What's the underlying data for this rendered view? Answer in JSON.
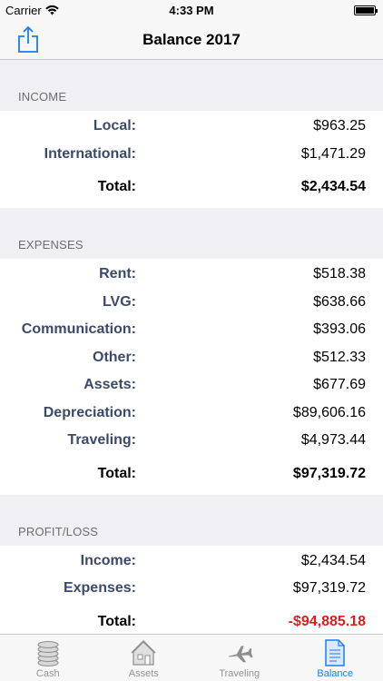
{
  "status_bar": {
    "carrier": "Carrier",
    "time": "4:33 PM"
  },
  "nav": {
    "title": "Balance 2017"
  },
  "income": {
    "header": "INCOME",
    "rows": [
      {
        "label": "Local:",
        "value": "$963.25"
      },
      {
        "label": "International:",
        "value": "$1,471.29"
      }
    ],
    "total": {
      "label": "Total:",
      "value": "$2,434.54"
    }
  },
  "expenses": {
    "header": "EXPENSES",
    "rows": [
      {
        "label": "Rent:",
        "value": "$518.38"
      },
      {
        "label": "LVG:",
        "value": "$638.66"
      },
      {
        "label": "Communication:",
        "value": "$393.06"
      },
      {
        "label": "Other:",
        "value": "$512.33"
      },
      {
        "label": "Assets:",
        "value": "$677.69"
      },
      {
        "label": "Depreciation:",
        "value": "$89,606.16"
      },
      {
        "label": "Traveling:",
        "value": "$4,973.44"
      }
    ],
    "total": {
      "label": "Total:",
      "value": "$97,319.72"
    }
  },
  "profit_loss": {
    "header": "PROFIT/LOSS",
    "rows": [
      {
        "label": "Income:",
        "value": "$2,434.54"
      },
      {
        "label": "Expenses:",
        "value": "$97,319.72"
      }
    ],
    "total": {
      "label": "Total:",
      "value": "-$94,885.18"
    }
  },
  "tabs": [
    {
      "label": "Cash",
      "icon": "coins-icon",
      "active": false
    },
    {
      "label": "Assets",
      "icon": "house-icon",
      "active": false
    },
    {
      "label": "Traveling",
      "icon": "airplane-icon",
      "active": false
    },
    {
      "label": "Balance",
      "icon": "document-icon",
      "active": true
    }
  ],
  "colors": {
    "accent": "#1b7cf2",
    "label": "#3b4a6b",
    "negative": "#e01e1e"
  }
}
